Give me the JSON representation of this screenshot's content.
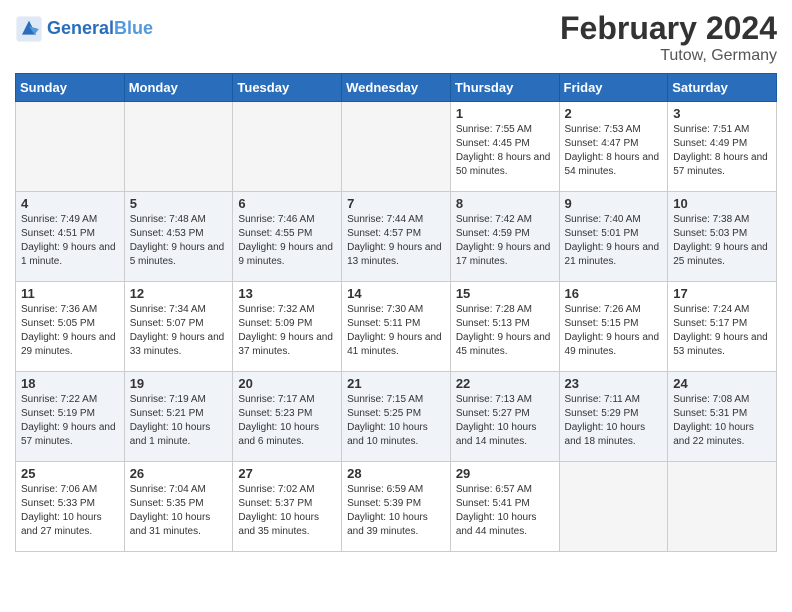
{
  "header": {
    "logo_text_general": "General",
    "logo_text_blue": "Blue",
    "title": "February 2024",
    "subtitle": "Tutow, Germany"
  },
  "days_of_week": [
    "Sunday",
    "Monday",
    "Tuesday",
    "Wednesday",
    "Thursday",
    "Friday",
    "Saturday"
  ],
  "weeks": [
    {
      "shaded": false,
      "days": [
        {
          "empty": true
        },
        {
          "empty": true
        },
        {
          "empty": true
        },
        {
          "empty": true
        },
        {
          "num": "1",
          "sunrise": "7:55 AM",
          "sunset": "4:45 PM",
          "daylight": "8 hours and 50 minutes."
        },
        {
          "num": "2",
          "sunrise": "7:53 AM",
          "sunset": "4:47 PM",
          "daylight": "8 hours and 54 minutes."
        },
        {
          "num": "3",
          "sunrise": "7:51 AM",
          "sunset": "4:49 PM",
          "daylight": "8 hours and 57 minutes."
        }
      ]
    },
    {
      "shaded": true,
      "days": [
        {
          "num": "4",
          "sunrise": "7:49 AM",
          "sunset": "4:51 PM",
          "daylight": "9 hours and 1 minute."
        },
        {
          "num": "5",
          "sunrise": "7:48 AM",
          "sunset": "4:53 PM",
          "daylight": "9 hours and 5 minutes."
        },
        {
          "num": "6",
          "sunrise": "7:46 AM",
          "sunset": "4:55 PM",
          "daylight": "9 hours and 9 minutes."
        },
        {
          "num": "7",
          "sunrise": "7:44 AM",
          "sunset": "4:57 PM",
          "daylight": "9 hours and 13 minutes."
        },
        {
          "num": "8",
          "sunrise": "7:42 AM",
          "sunset": "4:59 PM",
          "daylight": "9 hours and 17 minutes."
        },
        {
          "num": "9",
          "sunrise": "7:40 AM",
          "sunset": "5:01 PM",
          "daylight": "9 hours and 21 minutes."
        },
        {
          "num": "10",
          "sunrise": "7:38 AM",
          "sunset": "5:03 PM",
          "daylight": "9 hours and 25 minutes."
        }
      ]
    },
    {
      "shaded": false,
      "days": [
        {
          "num": "11",
          "sunrise": "7:36 AM",
          "sunset": "5:05 PM",
          "daylight": "9 hours and 29 minutes."
        },
        {
          "num": "12",
          "sunrise": "7:34 AM",
          "sunset": "5:07 PM",
          "daylight": "9 hours and 33 minutes."
        },
        {
          "num": "13",
          "sunrise": "7:32 AM",
          "sunset": "5:09 PM",
          "daylight": "9 hours and 37 minutes."
        },
        {
          "num": "14",
          "sunrise": "7:30 AM",
          "sunset": "5:11 PM",
          "daylight": "9 hours and 41 minutes."
        },
        {
          "num": "15",
          "sunrise": "7:28 AM",
          "sunset": "5:13 PM",
          "daylight": "9 hours and 45 minutes."
        },
        {
          "num": "16",
          "sunrise": "7:26 AM",
          "sunset": "5:15 PM",
          "daylight": "9 hours and 49 minutes."
        },
        {
          "num": "17",
          "sunrise": "7:24 AM",
          "sunset": "5:17 PM",
          "daylight": "9 hours and 53 minutes."
        }
      ]
    },
    {
      "shaded": true,
      "days": [
        {
          "num": "18",
          "sunrise": "7:22 AM",
          "sunset": "5:19 PM",
          "daylight": "9 hours and 57 minutes."
        },
        {
          "num": "19",
          "sunrise": "7:19 AM",
          "sunset": "5:21 PM",
          "daylight": "10 hours and 1 minute."
        },
        {
          "num": "20",
          "sunrise": "7:17 AM",
          "sunset": "5:23 PM",
          "daylight": "10 hours and 6 minutes."
        },
        {
          "num": "21",
          "sunrise": "7:15 AM",
          "sunset": "5:25 PM",
          "daylight": "10 hours and 10 minutes."
        },
        {
          "num": "22",
          "sunrise": "7:13 AM",
          "sunset": "5:27 PM",
          "daylight": "10 hours and 14 minutes."
        },
        {
          "num": "23",
          "sunrise": "7:11 AM",
          "sunset": "5:29 PM",
          "daylight": "10 hours and 18 minutes."
        },
        {
          "num": "24",
          "sunrise": "7:08 AM",
          "sunset": "5:31 PM",
          "daylight": "10 hours and 22 minutes."
        }
      ]
    },
    {
      "shaded": false,
      "days": [
        {
          "num": "25",
          "sunrise": "7:06 AM",
          "sunset": "5:33 PM",
          "daylight": "10 hours and 27 minutes."
        },
        {
          "num": "26",
          "sunrise": "7:04 AM",
          "sunset": "5:35 PM",
          "daylight": "10 hours and 31 minutes."
        },
        {
          "num": "27",
          "sunrise": "7:02 AM",
          "sunset": "5:37 PM",
          "daylight": "10 hours and 35 minutes."
        },
        {
          "num": "28",
          "sunrise": "6:59 AM",
          "sunset": "5:39 PM",
          "daylight": "10 hours and 39 minutes."
        },
        {
          "num": "29",
          "sunrise": "6:57 AM",
          "sunset": "5:41 PM",
          "daylight": "10 hours and 44 minutes."
        },
        {
          "empty": true
        },
        {
          "empty": true
        }
      ]
    }
  ]
}
